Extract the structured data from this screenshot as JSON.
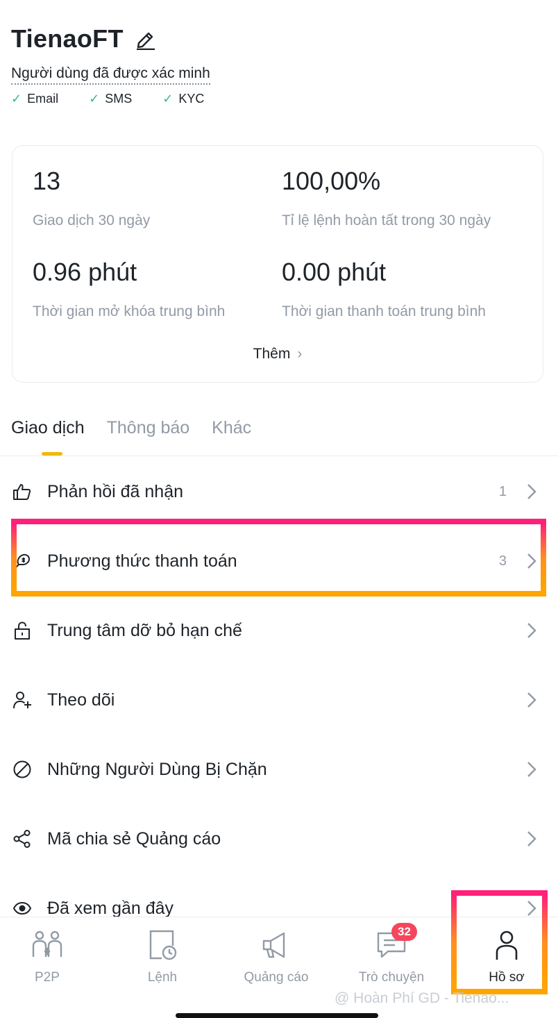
{
  "profile": {
    "username": "TienaoFT",
    "verified_label": "Người dùng đã được xác minh",
    "verifications": [
      "Email",
      "SMS",
      "KYC"
    ]
  },
  "stats": {
    "trades_30d_value": "13",
    "trades_30d_label": "Giao dịch 30 ngày",
    "completion_rate_value": "100,00%",
    "completion_rate_label": "Tỉ lệ lệnh hoàn tất trong 30 ngày",
    "avg_release_value": "0.96 phút",
    "avg_release_label": "Thời gian mở khóa trung bình",
    "avg_pay_value": "0.00 phút",
    "avg_pay_label": "Thời gian thanh toán trung bình",
    "more_label": "Thêm"
  },
  "tabs": [
    {
      "label": "Giao dịch",
      "active": true
    },
    {
      "label": "Thông báo",
      "active": false
    },
    {
      "label": "Khác",
      "active": false
    }
  ],
  "menu": [
    {
      "label": "Phản hồi đã nhận",
      "count": "1",
      "icon": "thumbs-up-icon"
    },
    {
      "label": "Phương thức thanh toán",
      "count": "3",
      "icon": "payment-method-icon"
    },
    {
      "label": "Trung tâm dỡ bỏ hạn chế",
      "count": "",
      "icon": "unlock-icon"
    },
    {
      "label": "Theo dõi",
      "count": "",
      "icon": "user-plus-icon"
    },
    {
      "label": "Những Người Dùng Bị Chặn",
      "count": "",
      "icon": "blocked-icon"
    },
    {
      "label": "Mã chia sẻ Quảng cáo",
      "count": "",
      "icon": "share-icon"
    },
    {
      "label": "Đã xem gần đây",
      "count": "",
      "icon": "eye-icon"
    }
  ],
  "bottom_nav": [
    {
      "label": "P2P",
      "icon": "p2p-icon"
    },
    {
      "label": "Lệnh",
      "icon": "orders-icon"
    },
    {
      "label": "Quảng cáo",
      "icon": "megaphone-icon"
    },
    {
      "label": "Trò chuyện",
      "icon": "chat-icon",
      "badge": "32"
    },
    {
      "label": "Hồ sơ",
      "icon": "profile-icon",
      "active": true
    }
  ],
  "watermark": "@ Hoàn Phí GD - Tienao...",
  "colors": {
    "accent": "#f0b90b",
    "check": "#2ebd85",
    "badge": "#f6465d",
    "muted": "#929aa5"
  }
}
